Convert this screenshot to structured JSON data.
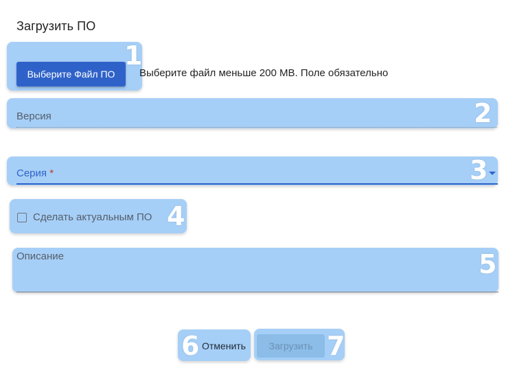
{
  "dialog": {
    "title": "Загрузить ПО"
  },
  "file": {
    "button_label": "Выберите Файл ПО",
    "hint": "Выберите файл меньше 200 MB. Поле обязательно"
  },
  "version": {
    "label": "Версия"
  },
  "series": {
    "label": "Серия",
    "required_mark": "*"
  },
  "current": {
    "label": "Сделать актуальным ПО",
    "checked": false
  },
  "description": {
    "label": "Описание"
  },
  "actions": {
    "cancel_label": "Отменить",
    "upload_label": "Загрузить"
  },
  "markers": [
    "1",
    "2",
    "3",
    "4",
    "5",
    "6",
    "7"
  ],
  "colors": {
    "highlight": "#a6cff7",
    "primary": "#2f62c9",
    "upload_disabled": "#8bbde8"
  }
}
